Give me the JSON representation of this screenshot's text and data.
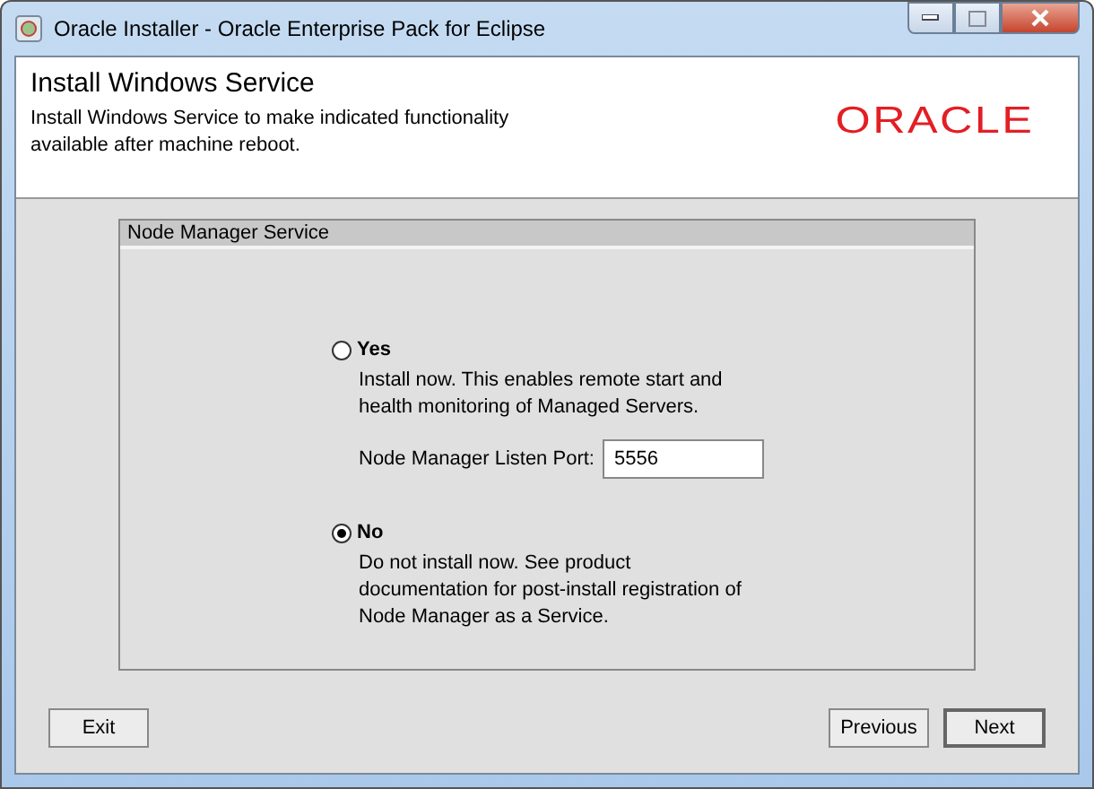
{
  "window": {
    "title": "Oracle Installer - Oracle Enterprise Pack for Eclipse"
  },
  "header": {
    "title": "Install Windows Service",
    "description": "Install Windows Service to make indicated functionality available after machine reboot.",
    "logo": "ORACLE"
  },
  "panel": {
    "title": "Node Manager Service",
    "options": [
      {
        "label": "Yes",
        "selected": false,
        "description": "Install now. This enables remote start and health monitoring of Managed Servers.",
        "field": {
          "label": "Node Manager Listen Port:",
          "value": "5556"
        }
      },
      {
        "label": "No",
        "selected": true,
        "description": "Do not install now. See product documentation for post-install registration of Node Manager as a Service."
      }
    ]
  },
  "buttons": [
    {
      "label": "Exit",
      "kind": "left",
      "default": false
    },
    {
      "label": "Previous",
      "kind": "right",
      "default": false
    },
    {
      "label": "Next",
      "kind": "right",
      "default": true
    }
  ]
}
